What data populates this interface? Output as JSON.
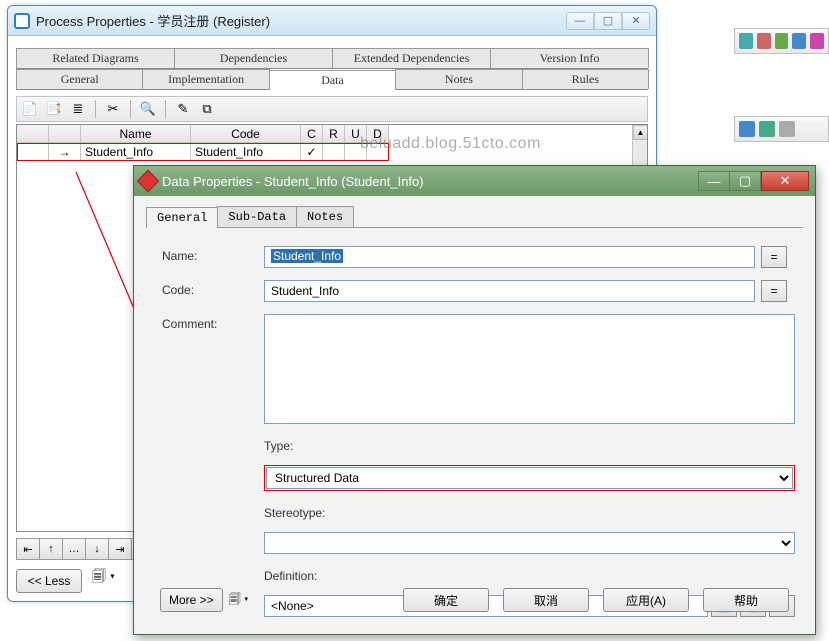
{
  "bg_icons": [
    "#4aa",
    "#c66",
    "#6a4",
    "#48c",
    "#c4a"
  ],
  "bg_icons2": [
    "#48c",
    "#4a8",
    "#aaa",
    "#aaa"
  ],
  "win1": {
    "title": "Process Properties - 学员注册 (Register)",
    "tabs_row1": {
      "related": "Related Diagrams",
      "deps": "Dependencies",
      "extdeps": "Extended Dependencies",
      "ver": "Version Info"
    },
    "tabs_row2": {
      "general": "General",
      "impl": "Implementation",
      "data": "Data",
      "notes": "Notes",
      "rules": "Rules"
    },
    "toolbar": {
      "i1": "📄",
      "i2": "📑",
      "i3": "≣",
      "cut": "✂",
      "find": "🔍",
      "brush": "✎",
      "tbls": "⧉"
    },
    "table": {
      "headers": {
        "blank1": "",
        "blank2": "",
        "name": "Name",
        "code": "Code",
        "c": "C",
        "r": "R",
        "u": "U",
        "d": "D"
      },
      "row": {
        "arrow": "→",
        "name": "Student_Info",
        "code": "Student_Info",
        "c": "✓"
      }
    },
    "nav": {
      "first": "⇤",
      "up": "↑",
      "insert": "…",
      "down": "↓",
      "last": "⇥",
      "del": "✕"
    },
    "less": "<< Less",
    "less_icon": "🗐"
  },
  "watermark": "beluadd.blog.51cto.com",
  "win2": {
    "title": "Data Properties - Student_Info (Student_Info)",
    "tabs": {
      "general": "General",
      "sub": "Sub-Data",
      "notes": "Notes"
    },
    "form": {
      "name_label": "Name:",
      "name_value": "Student_Info",
      "code_label": "Code:",
      "code_value": "Student_Info",
      "comment_label": "Comment:",
      "type_label": "Type:",
      "type_value": "Structured Data",
      "stereo_label": "Stereotype:",
      "stereo_value": "",
      "def_label": "Definition:",
      "def_value": "<None>",
      "eq": "="
    },
    "buttons": {
      "more": "More >>",
      "ok": "确定",
      "cancel": "取消",
      "apply": "应用(A)",
      "help": "帮助"
    }
  }
}
